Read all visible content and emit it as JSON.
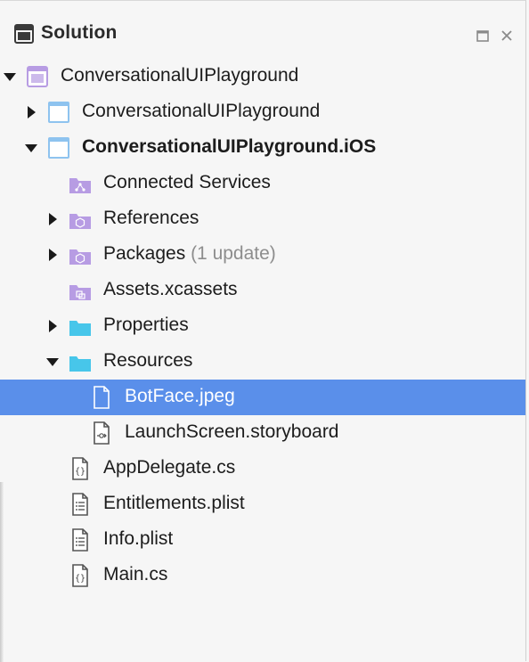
{
  "panel": {
    "title": "Solution",
    "header_icon": "pad-window-icon",
    "buttons": [
      {
        "name": "maximize-button",
        "icon": "square-icon"
      },
      {
        "name": "close-button",
        "icon": "close-icon"
      }
    ]
  },
  "tree": [
    {
      "label": "ConversationalUIPlayground",
      "note": "",
      "bold": false,
      "disclosure": "expanded",
      "icon": "solution-icon"
    },
    {
      "label": "ConversationalUIPlayground",
      "note": "",
      "bold": false,
      "disclosure": "collapsed",
      "icon": "project-icon"
    },
    {
      "label": "ConversationalUIPlayground.iOS",
      "note": "",
      "bold": true,
      "disclosure": "expanded",
      "icon": "project-icon"
    },
    {
      "label": "Connected Services",
      "note": "",
      "bold": false,
      "disclosure": "none",
      "icon": "connected-services-folder-icon"
    },
    {
      "label": "References",
      "note": "",
      "bold": false,
      "disclosure": "collapsed",
      "icon": "references-folder-icon"
    },
    {
      "label": "Packages",
      "note": "(1 update)",
      "bold": false,
      "disclosure": "collapsed",
      "icon": "packages-folder-icon"
    },
    {
      "label": "Assets.xcassets",
      "note": "",
      "bold": false,
      "disclosure": "none",
      "icon": "assets-folder-icon"
    },
    {
      "label": "Properties",
      "note": "",
      "bold": false,
      "disclosure": "collapsed",
      "icon": "folder-icon"
    },
    {
      "label": "Resources",
      "note": "",
      "bold": false,
      "disclosure": "expanded",
      "icon": "folder-icon"
    },
    {
      "label": "BotFace.jpeg",
      "note": "",
      "bold": false,
      "disclosure": "none",
      "icon": "file-icon",
      "selected": true
    },
    {
      "label": "LaunchScreen.storyboard",
      "note": "",
      "bold": false,
      "disclosure": "none",
      "icon": "storyboard-file-icon"
    },
    {
      "label": "AppDelegate.cs",
      "note": "",
      "bold": false,
      "disclosure": "none",
      "icon": "csharp-file-icon"
    },
    {
      "label": "Entitlements.plist",
      "note": "",
      "bold": false,
      "disclosure": "none",
      "icon": "plist-file-icon"
    },
    {
      "label": "Info.plist",
      "note": "",
      "bold": false,
      "disclosure": "none",
      "icon": "plist-file-icon"
    },
    {
      "label": "Main.cs",
      "note": "",
      "bold": false,
      "disclosure": "none",
      "icon": "csharp-file-icon"
    }
  ],
  "colors": {
    "selection": "#5a8fea",
    "folder": "#47c6ea",
    "special_folder": "#b79ce3",
    "project": "#8ec3ef",
    "note": "#8d8d8d"
  }
}
